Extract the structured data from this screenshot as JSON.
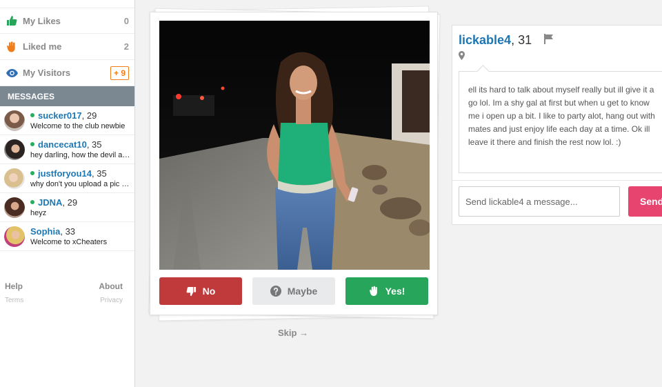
{
  "sidebar": {
    "nav": [
      {
        "label": "My Likes",
        "count": "0",
        "icon": "thumbs-up-icon",
        "color": "#27a55b"
      },
      {
        "label": "Liked me",
        "count": "2",
        "icon": "hand-icon",
        "color": "#f07d1a"
      },
      {
        "label": "My Visitors",
        "count": "+ 9",
        "icon": "eye-icon",
        "color": "#2f6db5"
      }
    ],
    "messages_header": "MESSAGES",
    "messages": [
      {
        "name": "sucker017",
        "age": ", 29",
        "preview": "Welcome to the club newbie",
        "online": true
      },
      {
        "name": "dancecat10",
        "age": ", 35",
        "preview": "hey darling, how the devil are you",
        "online": true
      },
      {
        "name": "justforyou14",
        "age": ", 35",
        "preview": "why don't you upload a pic please",
        "online": true
      },
      {
        "name": "JDNA",
        "age": ", 29",
        "preview": "heyz",
        "online": true
      },
      {
        "name": "Sophia",
        "age": ", 33",
        "preview": "Welcome to xCheaters",
        "online": false
      }
    ],
    "footer": {
      "help": "Help",
      "about": "About",
      "terms": "Terms",
      "privacy": "Privacy"
    }
  },
  "card": {
    "buttons": {
      "no": "No",
      "maybe": "Maybe",
      "yes": "Yes!"
    },
    "skip": "Skip →"
  },
  "profile": {
    "name": "lickable4",
    "age": ", 31",
    "bio": "ell its hard to talk about myself really but ill give it a go lol. Im a shy gal at first but when u get to know me i open up a bit. I like to party alot, hang out with mates and just enjoy life each day at a time. Ok ill leave it there and finish the rest now lol. :)",
    "message_placeholder": "Send lickable4 a message...",
    "send_label": "Send"
  },
  "colors": {
    "brand_blue": "#1e77b3",
    "no_red": "#c0393b",
    "yes_green": "#27a55b",
    "send_pink": "#e84470",
    "visitor_orange": "#f07d1a"
  }
}
